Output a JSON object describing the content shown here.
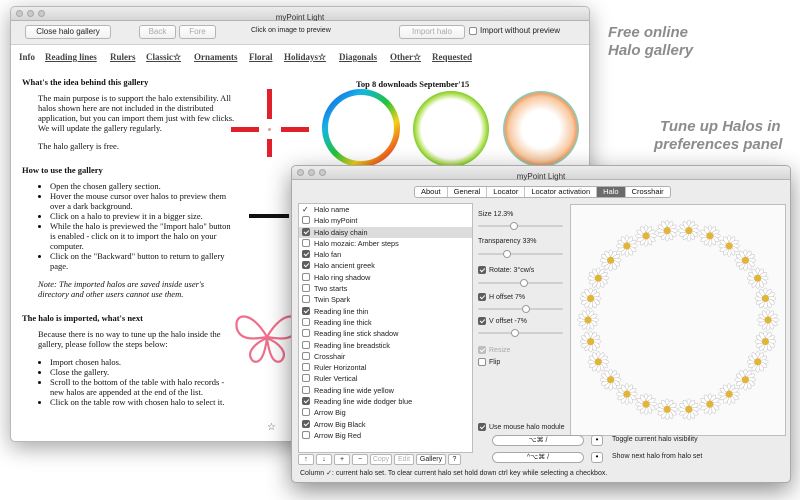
{
  "colors": {
    "accent_red": "#e0202a",
    "promo_gray": "#8c8c8c",
    "tab_active": "#6b6b6b",
    "daisy_yellow": "#e2b43a",
    "butterfly_pink": "#ee6f8b"
  },
  "gallery_window": {
    "title": "myPoint Light",
    "toolbar": {
      "close_label": "Close halo gallery",
      "back_label": "Back",
      "fore_label": "Fore",
      "preview_hint": "Click on image to preview",
      "import_label": "Import halo",
      "import_without_label": "Import without preview",
      "import_without_checked": false
    },
    "nav": [
      "Info",
      "Reading lines",
      "Rulers",
      "Classic☆",
      "Ornaments",
      "Floral",
      "Holidays☆",
      "Diagonals",
      "Other☆",
      "Requested"
    ],
    "section1_title": "What's the idea behind this gallery",
    "section1_p1": "The main purpose is to support the halo extensibility. All halos shown here are not included in the distributed application, but you can import them just with few clicks. We will update the gallery regularly.",
    "section1_p2": "The halo gallery is free.",
    "section2_title": "How to use the gallery",
    "section2_items": [
      "Open the chosen gallery section.",
      "Hover the mouse cursor over halos to preview them over a dark background.",
      "Click on a halo to preview it in a bigger size.",
      "While the halo is previewed the \"Import halo\" button is enabled - click on it to import the halo on your computer.",
      "Click on the \"Backward\" button to return to gallery page."
    ],
    "section2_note": "Note: The imported halos are saved inside user's directory and other users cannot use them.",
    "section3_title": "The halo is imported, what's next",
    "section3_p": "Because there is no way to tune up the halo inside the gallery, please follow the steps below:",
    "section3_items": [
      "Import chosen halos.",
      "Close the gallery.",
      "Scroll to the bottom of the table with halo records - new halos are appended at the end of the list.",
      "Click on the table row with chosen halo to select it."
    ],
    "top8_title": "Top 8 downloads September'15",
    "star_glyph": "☆"
  },
  "promo": {
    "line1": "Free online",
    "line2": "Halo gallery",
    "line3": "Tune up Halos in",
    "line4": "preferences panel"
  },
  "prefs_window": {
    "title": "myPoint Light",
    "tabs": [
      {
        "label": "About",
        "active": false
      },
      {
        "label": "General",
        "active": false
      },
      {
        "label": "Locator",
        "active": false
      },
      {
        "label": "Locator activation",
        "active": false
      },
      {
        "label": "Halo",
        "active": true
      },
      {
        "label": "Crosshair",
        "active": false
      }
    ],
    "list_header": {
      "tick": "✓",
      "label": "Halo name"
    },
    "halos": [
      {
        "name": "Halo myPoint",
        "checked": false,
        "selected": false
      },
      {
        "name": "Halo daisy chain",
        "checked": true,
        "selected": true
      },
      {
        "name": "Halo mozaic: Amber steps",
        "checked": false,
        "selected": false
      },
      {
        "name": "Halo fan",
        "checked": true,
        "selected": false
      },
      {
        "name": "Halo ancient greek",
        "checked": true,
        "selected": false
      },
      {
        "name": "Halo ring shadow",
        "checked": false,
        "selected": false
      },
      {
        "name": "Two starts",
        "checked": false,
        "selected": false
      },
      {
        "name": "Twin Spark",
        "checked": false,
        "selected": false
      },
      {
        "name": "Reading line thin",
        "checked": true,
        "selected": false
      },
      {
        "name": "Reading line thick",
        "checked": false,
        "selected": false
      },
      {
        "name": "Reading line stick shadow",
        "checked": false,
        "selected": false
      },
      {
        "name": "Reading line breadstick",
        "checked": false,
        "selected": false
      },
      {
        "name": "Crosshair",
        "checked": false,
        "selected": false
      },
      {
        "name": "Ruler Horizontal",
        "checked": false,
        "selected": false
      },
      {
        "name": "Ruler Vertical",
        "checked": false,
        "selected": false
      },
      {
        "name": "Reading line wide yellow",
        "checked": false,
        "selected": false
      },
      {
        "name": "Reading line wide dodger blue",
        "checked": true,
        "selected": false
      },
      {
        "name": "Arrow Big",
        "checked": false,
        "selected": false
      },
      {
        "name": "Arrow Big Black",
        "checked": true,
        "selected": false
      },
      {
        "name": "Arrow Big Red",
        "checked": false,
        "selected": false
      }
    ],
    "list_buttons": {
      "up": "↑",
      "down": "↓",
      "add": "+",
      "remove": "−",
      "copy": "Copy",
      "edit": "Edit",
      "gallery": "Gallery",
      "help": "?"
    },
    "settings": {
      "size_label": "Size 12.3%",
      "size_value": 0.42,
      "transparency_label": "Transparency 33%",
      "transparency_value": 0.33,
      "rotate_label": "Rotate: 3°cw/s",
      "rotate_checked": true,
      "rotate_value": 0.55,
      "hoffset_label": "H offset 7%",
      "hoffset_checked": true,
      "hoffset_value": 0.57,
      "voffset_label": "V offset -7%",
      "voffset_checked": true,
      "voffset_value": 0.43,
      "resize_label": "Resize",
      "resize_checked": true,
      "flip_label": "Flip",
      "flip_checked": false
    },
    "mouse_module_label": "Use mouse halo module",
    "mouse_module_checked": true,
    "shortcut1": "⌥⌘ /",
    "shortcut1_label": "Toggle current halo visibility",
    "shortcut2": "^⌥⌘ /",
    "shortcut2_label": "Show next halo from halo set",
    "dot_glyph": "•",
    "status": "Column ✓: current halo set. To clear current halo set hold down ctrl key while selecting a checkbox."
  }
}
